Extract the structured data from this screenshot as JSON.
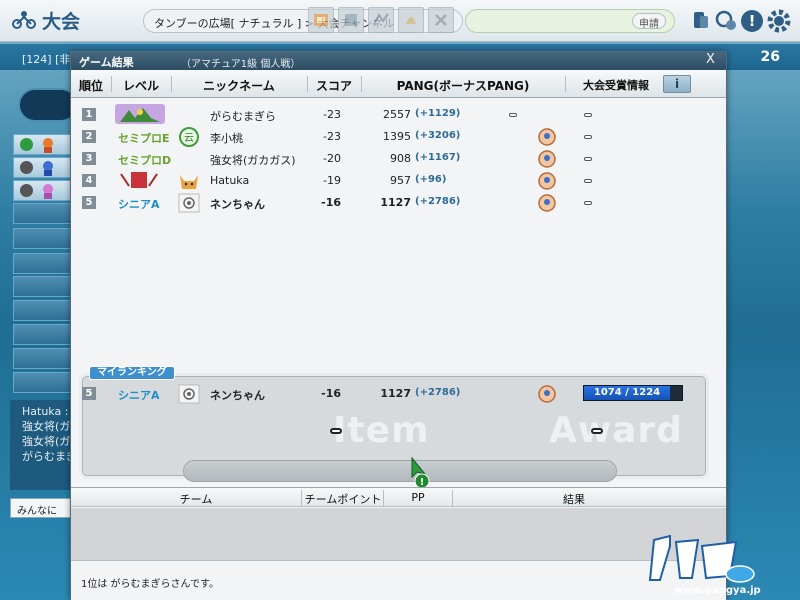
{
  "topbar": {
    "app_title": "大会",
    "breadcrumb": "タンブーの広場[ ナチュラル ] > 大会チャンネル",
    "apply_label": "申請",
    "icons": [
      "trophy-icon",
      "users-icon",
      "question-icon",
      "gear-icon"
    ]
  },
  "background": {
    "room_label": "[124] [非",
    "round_count": "26",
    "chat_lines": [
      "Hatuka :",
      "強女将(ガ",
      "強女将(ガ",
      "がらむまぎ"
    ],
    "chat_input": "みんなに"
  },
  "dialog": {
    "title": "ゲーム結果",
    "subtitle": "（アマチュア1級 個人戦）",
    "close_label": "X",
    "headers": {
      "rank": "順位",
      "level": "レベル",
      "nickname": "ニックネーム",
      "score": "スコア",
      "pang": "PANG(ボーナスPANG)",
      "award_info": "大会受賞情報",
      "info_button": "i"
    },
    "rows": [
      {
        "rank": "1",
        "level": "",
        "level_icon": "level-emblem",
        "nickname": "がらむまぎら",
        "score": "-23",
        "pang": "2557",
        "bonus": "(+1129)",
        "award": "none"
      },
      {
        "rank": "2",
        "level": "セミプロE",
        "level_color": "#6aa22e",
        "nickname": "李小桃",
        "score": "-23",
        "pang": "1395",
        "bonus": "(+3206)",
        "award": "medal"
      },
      {
        "rank": "3",
        "level": "セミプロD",
        "level_color": "#6aa22e",
        "nickname": "強女将(ガカガス)",
        "score": "-20",
        "pang": "908",
        "bonus": "(+1167)",
        "award": "medal"
      },
      {
        "rank": "4",
        "level": "",
        "level_icon": "rank-emblem",
        "nickname": "Hatuka",
        "score": "-19",
        "pang": "957",
        "bonus": "(+96)",
        "award": "medal"
      },
      {
        "rank": "5",
        "level": "シニアA",
        "level_color": "#1b8fc6",
        "nickname": "ネンちゃん",
        "score": "-16",
        "pang": "1127",
        "bonus": "(+2786)",
        "award": "medal"
      }
    ],
    "my_ranking": {
      "tab_label": "マイランキング",
      "rank": "5",
      "level": "シニアA",
      "nickname": "ネンちゃん",
      "score": "-16",
      "pang": "1127",
      "bonus": "(+2786)",
      "progress_text": "1074 / 1224",
      "progress_fraction": 0.877,
      "item_watermark": "Item",
      "award_watermark": "Award"
    },
    "team_headers": {
      "team": "チーム",
      "team_point": "チームポイント",
      "pp": "PP",
      "result": "結果"
    },
    "status": "1位は がらむまぎらさんです。"
  },
  "branding": {
    "logo_text": "パンヤ",
    "url": "www.pangya.jp"
  }
}
